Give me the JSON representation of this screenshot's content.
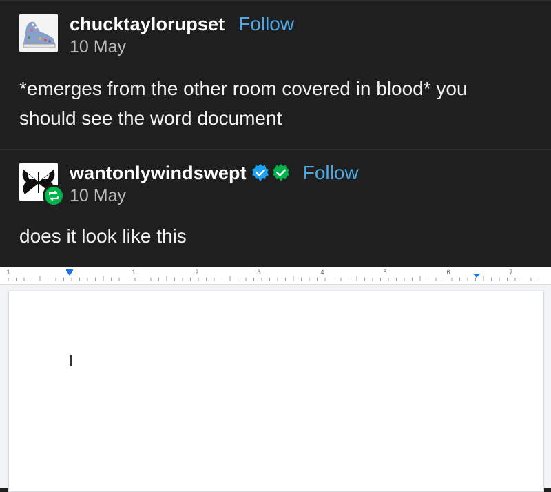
{
  "post1": {
    "username": "chucktaylorupset",
    "follow_label": "Follow",
    "date": "10 May",
    "text": "*emerges from the other room covered in blood* you should see the word document",
    "avatar_icon": "sneaker-avatar"
  },
  "post2": {
    "username": "wantonlywindswept",
    "follow_label": "Follow",
    "date": "10 May",
    "text": "does it look like this",
    "avatar_icon": "butterfly-avatar",
    "badges": [
      "blue-checkmark-icon",
      "green-checkmark-icon"
    ],
    "reblog_icon": "reblog-icon"
  },
  "ruler": {
    "numbers": [
      "1",
      "1",
      "2",
      "3",
      "4",
      "5",
      "6",
      "7"
    ]
  },
  "colors": {
    "background": "#1f1f1f",
    "follow": "#4aa8e6",
    "verified_blue": "#1da1f2",
    "verified_green": "#00b34a",
    "ruler_marker": "#1a73e8"
  }
}
